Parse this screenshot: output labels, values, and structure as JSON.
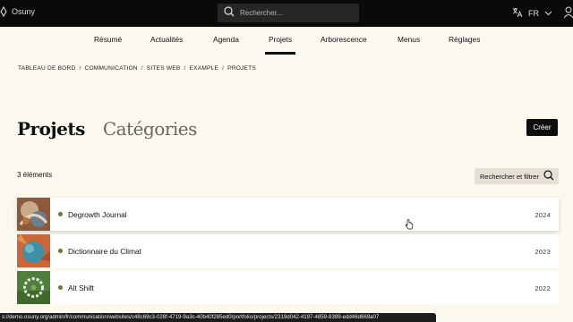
{
  "topbar": {
    "brand": "Osuny",
    "search_placeholder": "Rechercher...",
    "lang": "FR"
  },
  "nav": {
    "items": [
      "Résumé",
      "Actualités",
      "Agenda",
      "Projets",
      "Arborescence",
      "Menus",
      "Réglages"
    ],
    "active": "Projets"
  },
  "breadcrumb": {
    "items": [
      "TABLEAU DE BORD",
      "COMMUNICATION",
      "SITES WEB",
      "EXAMPLE",
      "PROJETS"
    ],
    "separator": "/"
  },
  "tabs": {
    "active": "Projets",
    "inactive": "Catégories"
  },
  "actions": {
    "create_label": "Créer",
    "filter_label": "Rechercher et filtrer"
  },
  "count_label": "3 éléments",
  "projects": [
    {
      "title": "Degrowth Journal",
      "year": "2024"
    },
    {
      "title": "Dictionnaire du Climat",
      "year": "2023"
    },
    {
      "title": "Alt Shift",
      "year": "2022"
    }
  ],
  "status_url": "s://demo.osuny.org/admin/fr/communication/websites/c48c69c3-028f-4719-9a3c-40b40f285ed0/portfolio/projects/2319d042-4197-4859-8399-edd46d669a07",
  "colors": {
    "topbar_bg": "#0a0a0a",
    "page_bg": "#fbf8ee",
    "status_dot": "#6b7a1f",
    "primary_button": "#0e0e0e",
    "filter_button": "#e5e0d3"
  },
  "icons": {
    "brand": "diamond-icon",
    "search": "search-icon",
    "translate": "translate-icon",
    "chevron": "chevron-down-icon",
    "user": "user-icon"
  }
}
